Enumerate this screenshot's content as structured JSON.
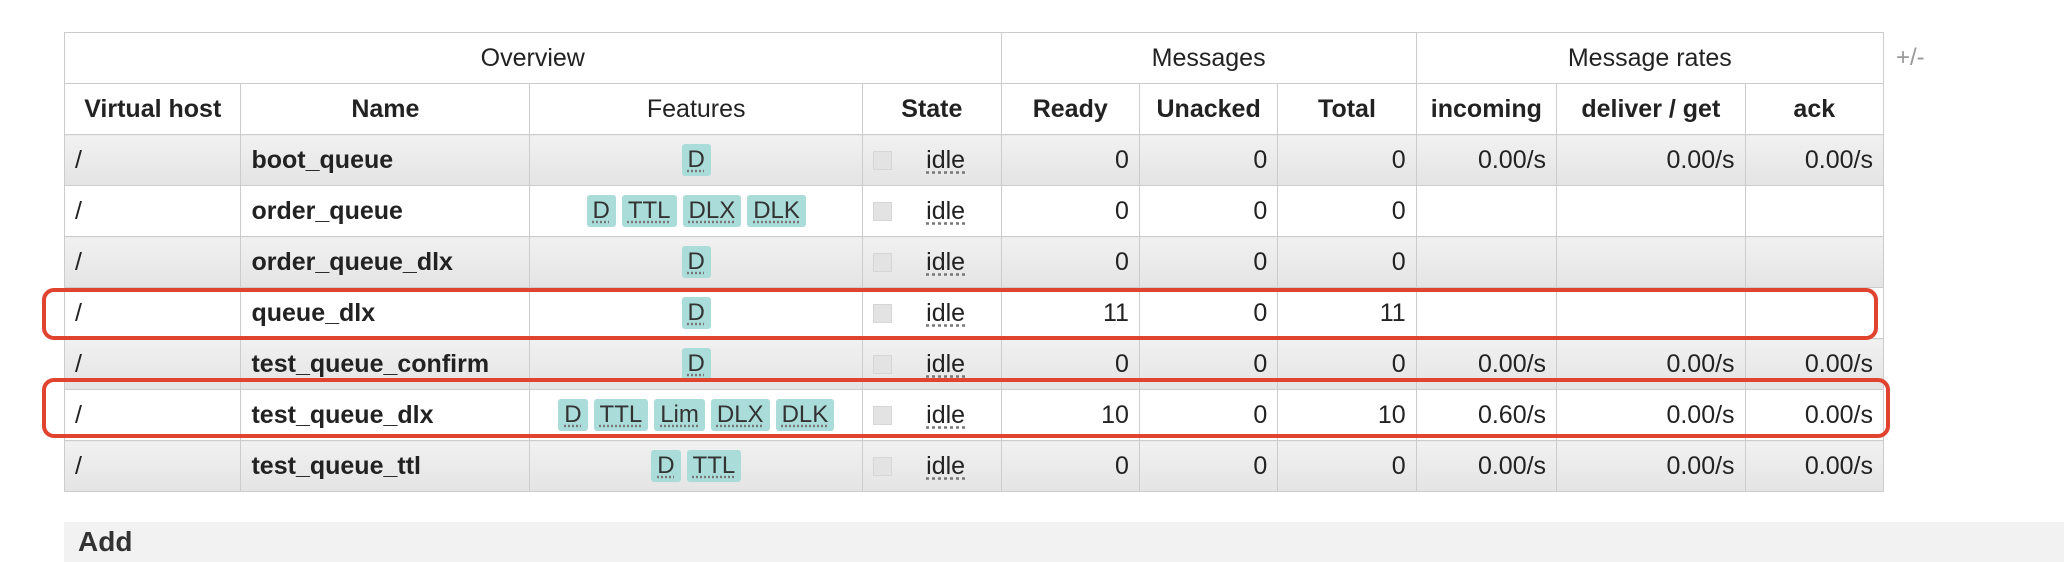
{
  "header_groups": {
    "overview": "Overview",
    "messages": "Messages",
    "message_rates": "Message rates"
  },
  "columns": {
    "vhost": "Virtual host",
    "name": "Name",
    "features": "Features",
    "state": "State",
    "ready": "Ready",
    "unacked": "Unacked",
    "total": "Total",
    "incoming": "incoming",
    "deliver_get": "deliver / get",
    "ack": "ack"
  },
  "plus_minus": "+/-",
  "rows": [
    {
      "vhost": "/",
      "name": "boot_queue",
      "features": [
        "D"
      ],
      "state": "idle",
      "ready": "0",
      "unacked": "0",
      "total": "0",
      "incoming": "0.00/s",
      "deliver_get": "0.00/s",
      "ack": "0.00/s"
    },
    {
      "vhost": "/",
      "name": "order_queue",
      "features": [
        "D",
        "TTL",
        "DLX",
        "DLK"
      ],
      "state": "idle",
      "ready": "0",
      "unacked": "0",
      "total": "0",
      "incoming": "",
      "deliver_get": "",
      "ack": ""
    },
    {
      "vhost": "/",
      "name": "order_queue_dlx",
      "features": [
        "D"
      ],
      "state": "idle",
      "ready": "0",
      "unacked": "0",
      "total": "0",
      "incoming": "",
      "deliver_get": "",
      "ack": ""
    },
    {
      "vhost": "/",
      "name": "queue_dlx",
      "features": [
        "D"
      ],
      "state": "idle",
      "ready": "11",
      "unacked": "0",
      "total": "11",
      "incoming": "",
      "deliver_get": "",
      "ack": ""
    },
    {
      "vhost": "/",
      "name": "test_queue_confirm",
      "features": [
        "D"
      ],
      "state": "idle",
      "ready": "0",
      "unacked": "0",
      "total": "0",
      "incoming": "0.00/s",
      "deliver_get": "0.00/s",
      "ack": "0.00/s"
    },
    {
      "vhost": "/",
      "name": "test_queue_dlx",
      "features": [
        "D",
        "TTL",
        "Lim",
        "DLX",
        "DLK"
      ],
      "state": "idle",
      "ready": "10",
      "unacked": "0",
      "total": "10",
      "incoming": "0.60/s",
      "deliver_get": "0.00/s",
      "ack": "0.00/s"
    },
    {
      "vhost": "/",
      "name": "test_queue_ttl",
      "features": [
        "D",
        "TTL"
      ],
      "state": "idle",
      "ready": "0",
      "unacked": "0",
      "total": "0",
      "incoming": "0.00/s",
      "deliver_get": "0.00/s",
      "ack": "0.00/s"
    }
  ],
  "add_section": "Add",
  "colors": {
    "badge": "#aadcda",
    "highlight": "#e0442e",
    "border": "#cccccc"
  }
}
